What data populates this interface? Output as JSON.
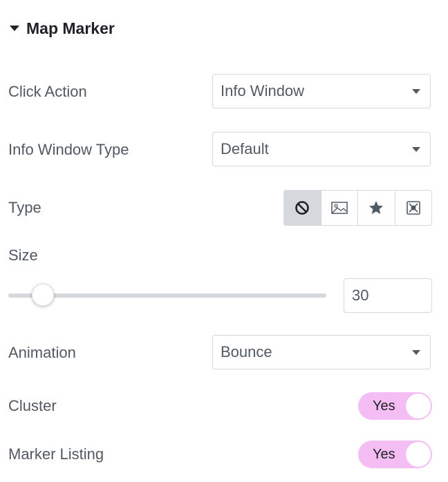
{
  "section": {
    "title": "Map Marker"
  },
  "click_action": {
    "label": "Click Action",
    "value": "Info Window"
  },
  "info_window_type": {
    "label": "Info Window Type",
    "value": "Default"
  },
  "type": {
    "label": "Type",
    "options": [
      "ban-icon",
      "image-icon",
      "star-icon",
      "custom-icon"
    ],
    "selected_index": 0
  },
  "size": {
    "label": "Size",
    "value": "30",
    "slider_fraction": 0.1
  },
  "animation": {
    "label": "Animation",
    "value": "Bounce"
  },
  "cluster": {
    "label": "Cluster",
    "state": "Yes"
  },
  "marker_listing": {
    "label": "Marker Listing",
    "state": "Yes"
  },
  "colors": {
    "accent": "#f4bdf4",
    "border": "#d5d8dc",
    "text": "#515962"
  }
}
